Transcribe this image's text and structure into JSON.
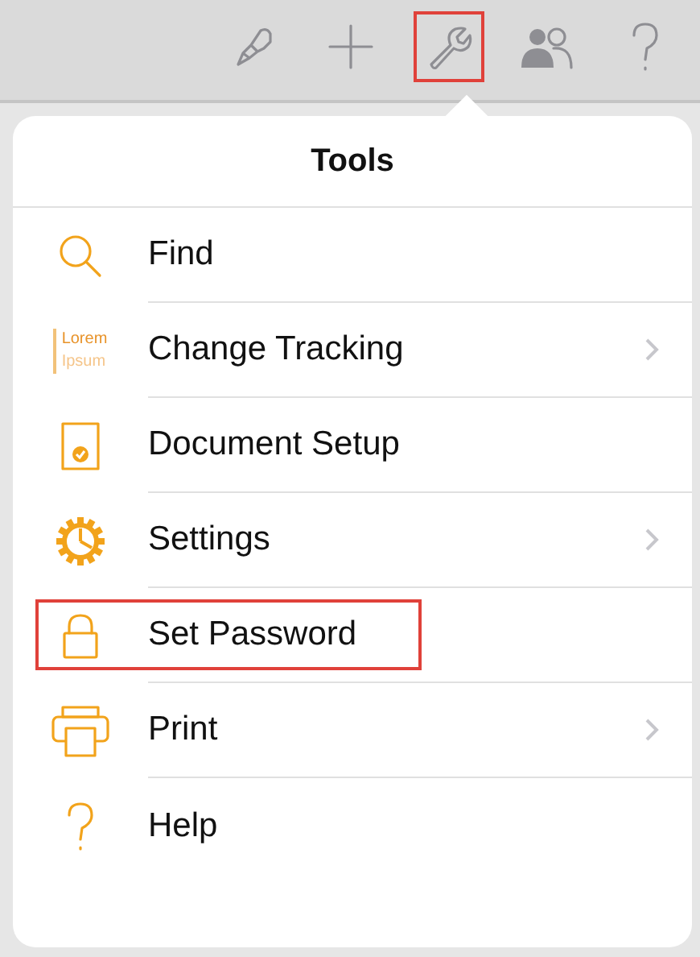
{
  "toolbar": {
    "buttons": [
      {
        "kind": "brush",
        "highlighted": false
      },
      {
        "kind": "plus",
        "highlighted": false
      },
      {
        "kind": "wrench",
        "highlighted": true
      },
      {
        "kind": "people",
        "highlighted": false
      },
      {
        "kind": "help",
        "highlighted": false
      }
    ]
  },
  "popover": {
    "title": "Tools",
    "items": [
      {
        "kind": "search",
        "label": "Find",
        "submenu": false,
        "highlighted": false
      },
      {
        "kind": "lorem",
        "label": "Change Tracking",
        "icon_lines": [
          "Lorem",
          "Ipsum"
        ],
        "submenu": true,
        "highlighted": false
      },
      {
        "kind": "document",
        "label": "Document Setup",
        "submenu": false,
        "highlighted": false
      },
      {
        "kind": "gear",
        "label": "Settings",
        "submenu": true,
        "highlighted": false
      },
      {
        "kind": "lock",
        "label": "Set Password",
        "submenu": false,
        "highlighted": true
      },
      {
        "kind": "printer",
        "label": "Print",
        "submenu": true,
        "highlighted": false
      },
      {
        "kind": "help",
        "label": "Help",
        "submenu": false,
        "highlighted": false
      }
    ]
  }
}
